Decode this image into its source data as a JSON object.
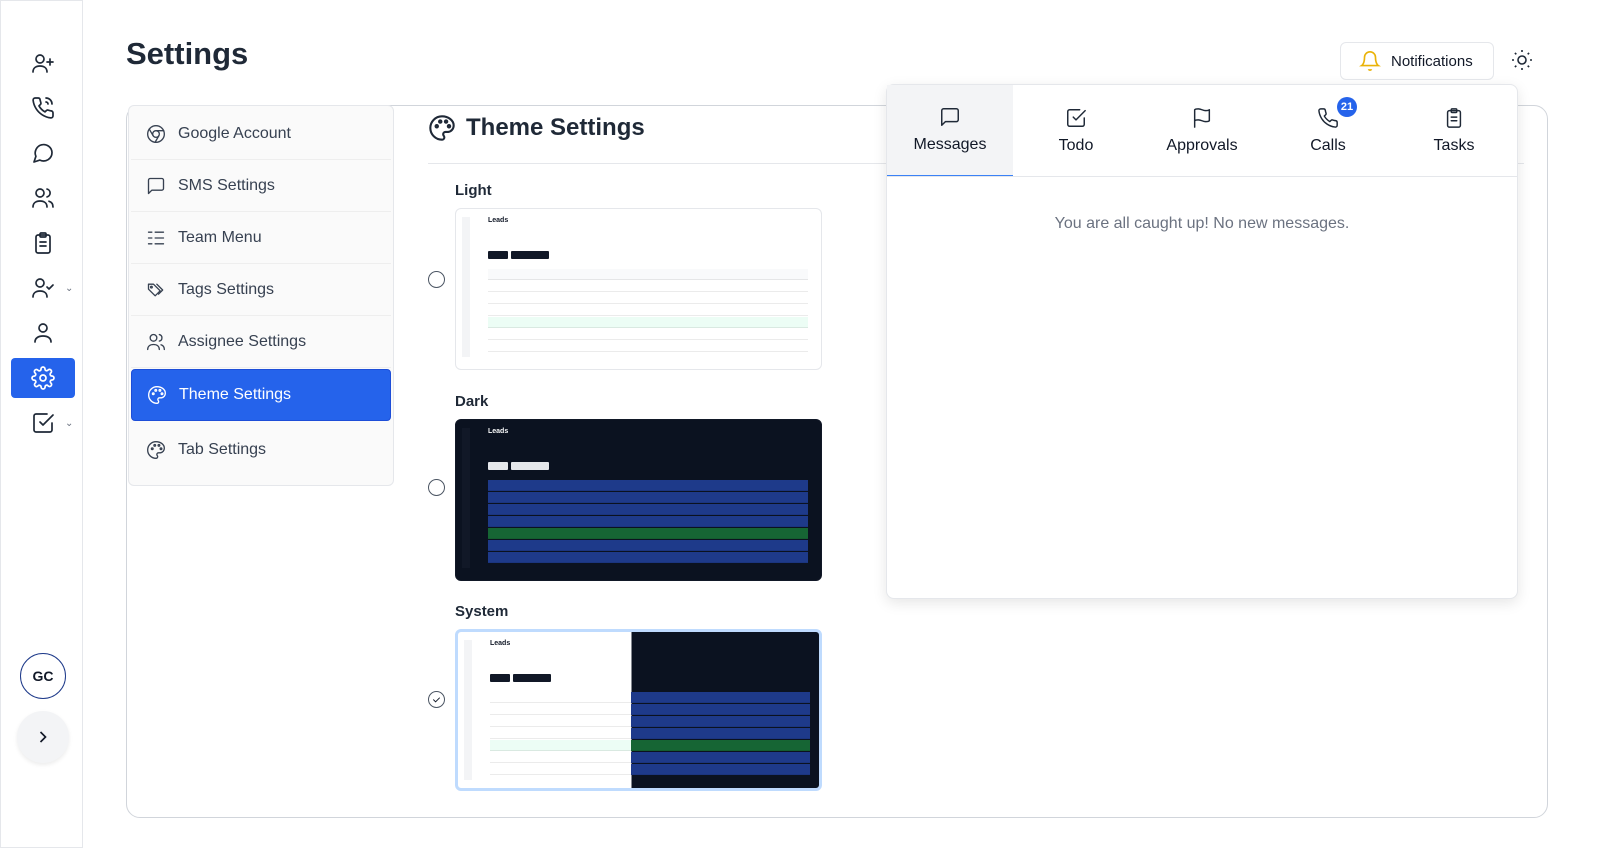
{
  "page": {
    "title": "Settings"
  },
  "header": {
    "notifications_label": "Notifications"
  },
  "rail": {
    "items": [
      "add-user",
      "phone",
      "chat",
      "users",
      "clipboard",
      "user-check",
      "user",
      "settings",
      "tasks"
    ],
    "avatar_initials": "GC"
  },
  "settings_menu": {
    "items": [
      {
        "label": "Google Account",
        "icon": "chrome-icon"
      },
      {
        "label": "SMS Settings",
        "icon": "message-square-icon"
      },
      {
        "label": "Team Menu",
        "icon": "list-checks-icon"
      },
      {
        "label": "Tags Settings",
        "icon": "tags-icon"
      },
      {
        "label": "Assignee Settings",
        "icon": "users-icon"
      },
      {
        "label": "Theme Settings",
        "icon": "palette-icon"
      },
      {
        "label": "Tab Settings",
        "icon": "palette-icon"
      }
    ],
    "active": "Theme Settings"
  },
  "theme": {
    "title": "Theme Settings",
    "options": [
      {
        "label": "Light",
        "selected": false
      },
      {
        "label": "Dark",
        "selected": false
      },
      {
        "label": "System",
        "selected": true
      }
    ],
    "preview_title": "Leads"
  },
  "notifications_panel": {
    "tabs": [
      {
        "label": "Messages",
        "icon": "message-square-icon"
      },
      {
        "label": "Todo",
        "icon": "check-square-icon"
      },
      {
        "label": "Approvals",
        "icon": "flag-icon"
      },
      {
        "label": "Calls",
        "icon": "phone-call-icon",
        "badge": "21"
      },
      {
        "label": "Tasks",
        "icon": "clipboard-icon"
      }
    ],
    "active_tab": "Messages",
    "empty_message": "You are all caught up! No new messages."
  },
  "colors": {
    "accent": "#2563eb",
    "bell": "#eab308",
    "badge": "#2563eb"
  }
}
